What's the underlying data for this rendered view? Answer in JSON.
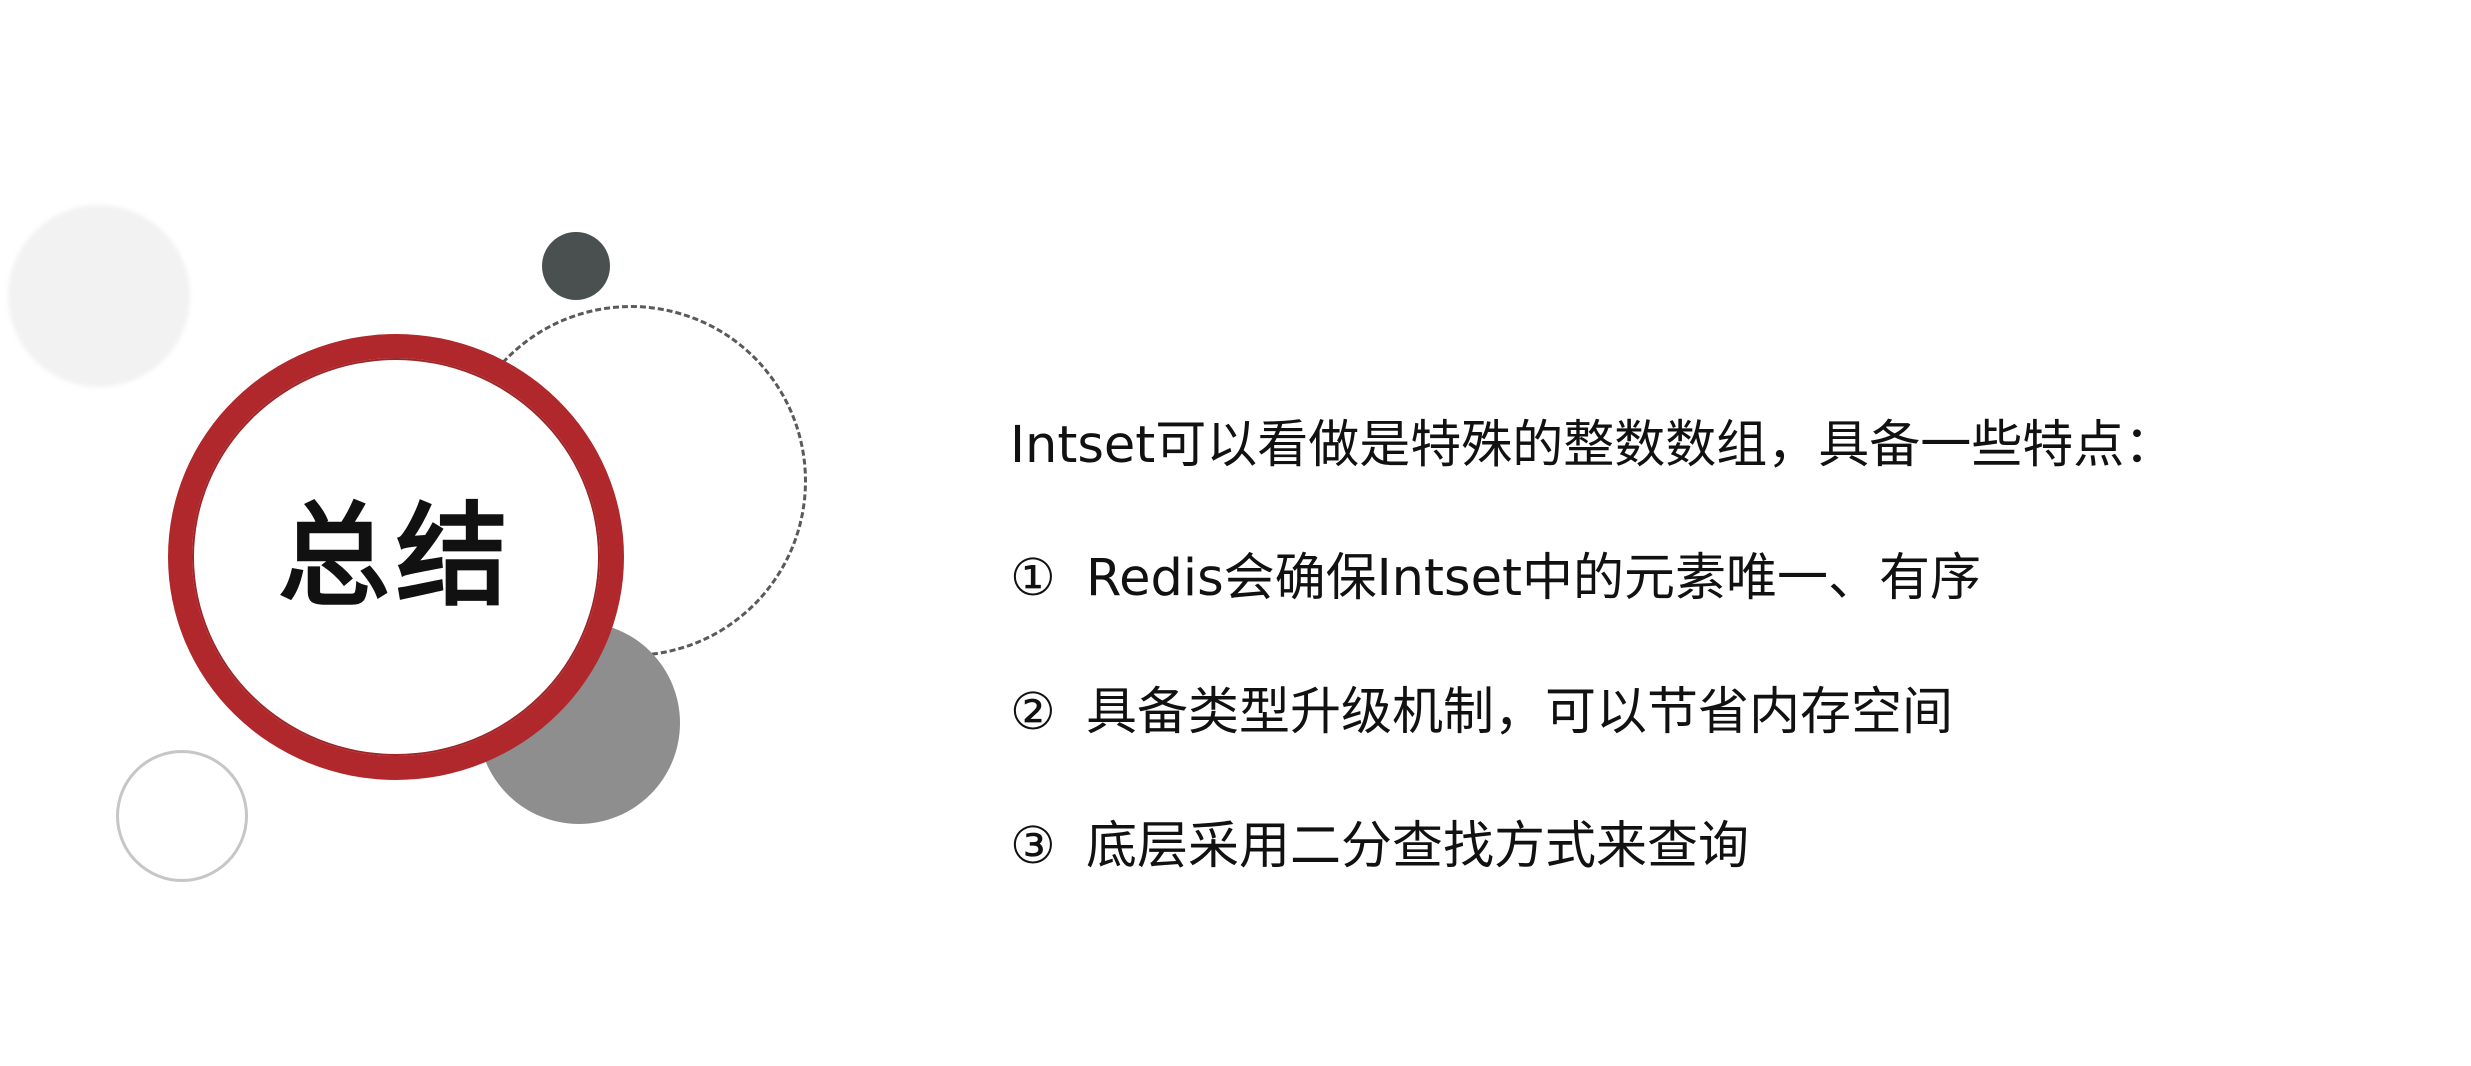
{
  "slide": {
    "title": "总结",
    "intro": "Intset可以看做是特殊的整数数组，具备一些特点：",
    "points": [
      {
        "marker": "①",
        "text": "Redis会确保Intset中的元素唯一、有序"
      },
      {
        "marker": "②",
        "text": "具备类型升级机制，可以节省内存空间"
      },
      {
        "marker": "③",
        "text": "底层采用二分查找方式来查询"
      }
    ]
  },
  "colors": {
    "accent": "#b0282b",
    "dark_dot": "#4a4f4f",
    "gray_disc": "#8e8e8e",
    "text": "#111111"
  }
}
